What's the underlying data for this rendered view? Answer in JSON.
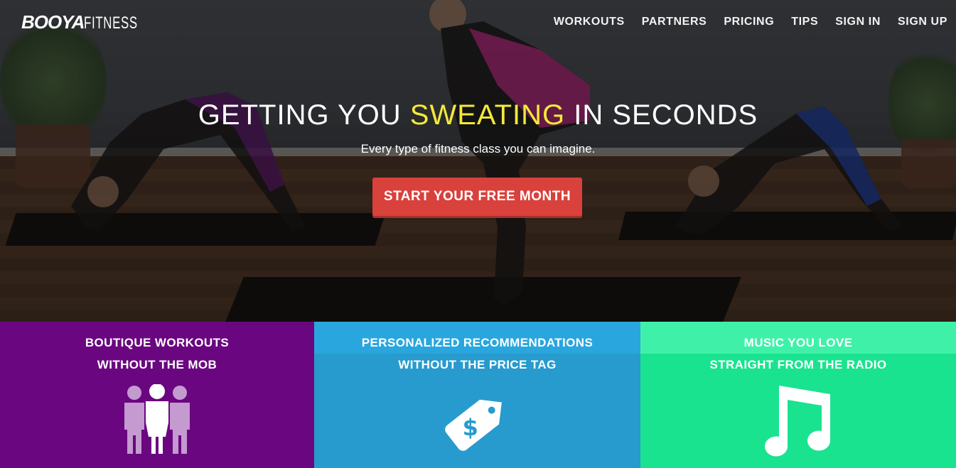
{
  "brand": {
    "logo_bold": "BOOYA",
    "logo_thin": "FITNESS"
  },
  "nav": [
    {
      "label": "WORKOUTS"
    },
    {
      "label": "PARTNERS"
    },
    {
      "label": "PRICING"
    },
    {
      "label": "TIPS"
    },
    {
      "label": "SIGN IN"
    },
    {
      "label": "SIGN UP"
    }
  ],
  "hero": {
    "headline_pre": "GETTING YOU ",
    "headline_highlight": "SWEATING",
    "headline_post": " IN SECONDS",
    "subline": "Every type of fitness class you can imagine.",
    "cta_label": "START YOUR FREE MONTH",
    "highlight_color": "#f4e93a",
    "cta_color": "#d9413c"
  },
  "features": [
    {
      "line1": "BOUTIQUE WORKOUTS",
      "line2": "WITHOUT THE MOB",
      "icon": "people-icon",
      "color": "#6a0780"
    },
    {
      "line1": "PERSONALIZED RECOMMENDATIONS",
      "line2": "WITHOUT THE PRICE TAG",
      "icon": "price-tag-icon",
      "color": "#279bcd"
    },
    {
      "line1": "MUSIC YOU LOVE",
      "line2": "STRAIGHT FROM THE RADIO",
      "icon": "music-note-icon",
      "color": "#1ae38f"
    }
  ]
}
